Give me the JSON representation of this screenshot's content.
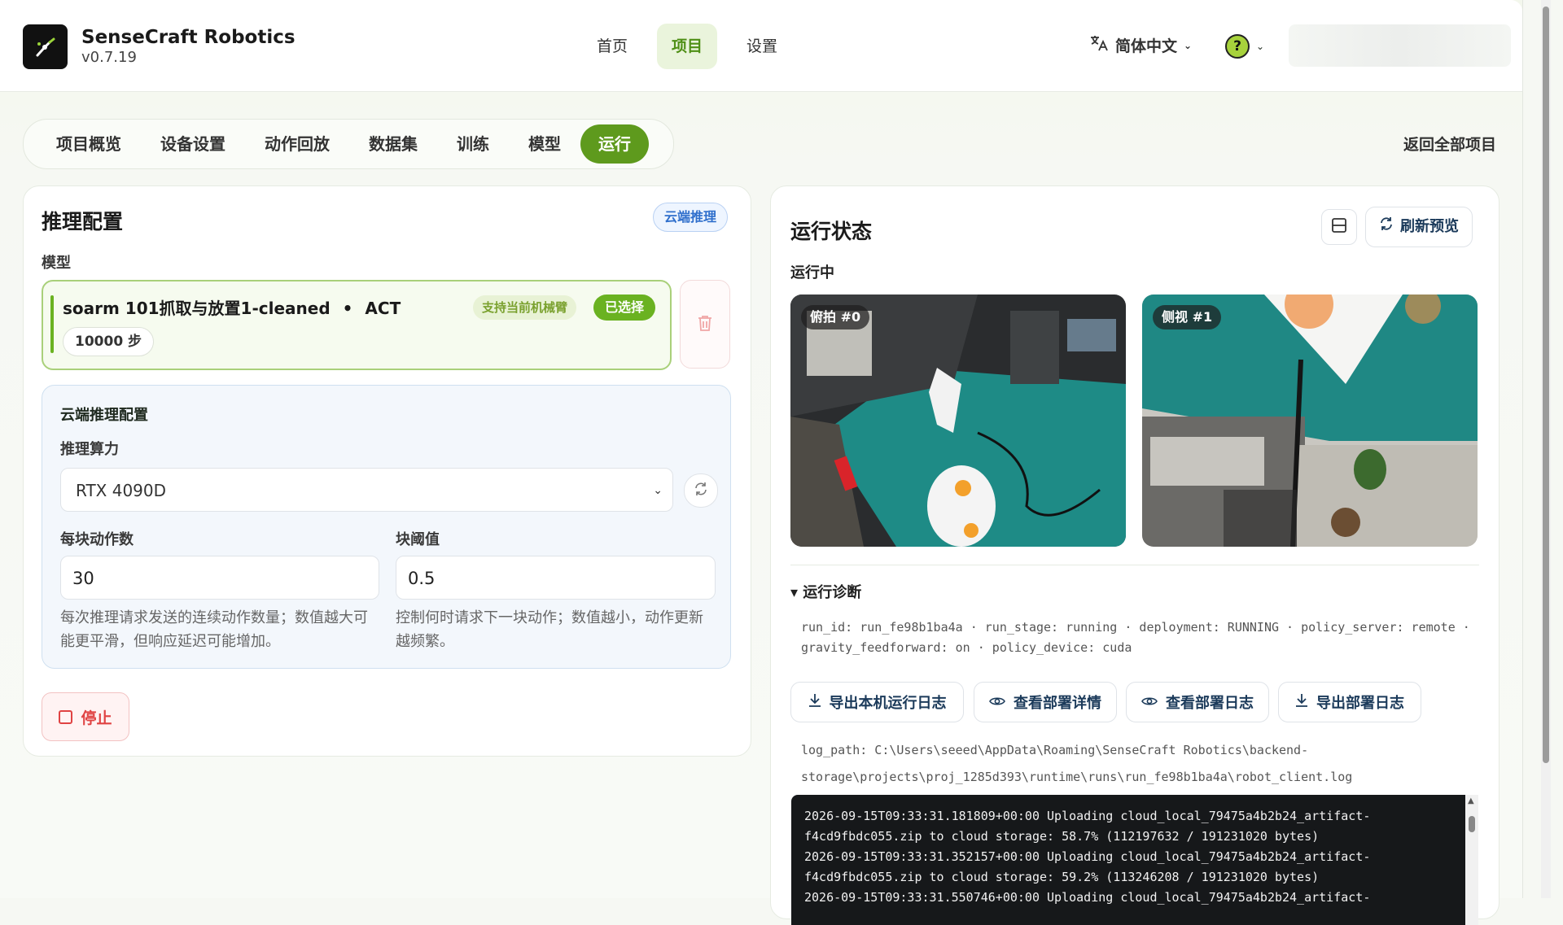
{
  "app": {
    "name": "SenseCraft Robotics",
    "version": "v0.7.19"
  },
  "nav": {
    "items": [
      "首页",
      "项目",
      "设置"
    ],
    "active": "项目"
  },
  "header": {
    "language": "简体中文"
  },
  "tabs": {
    "items": [
      "项目概览",
      "设备设置",
      "动作回放",
      "数据集",
      "训练",
      "模型",
      "运行"
    ],
    "active": "运行",
    "back_all": "返回全部项目"
  },
  "inference": {
    "title": "推理配置",
    "mode_badge": "云端推理",
    "model_label": "模型",
    "model": {
      "name": "soarm 101抓取与放置1-cleaned",
      "separator": "•",
      "policy": "ACT",
      "support_badge": "支持当前机械臂",
      "selected_badge": "已选择",
      "steps": "10000 步"
    },
    "cloud": {
      "title": "云端推理配置",
      "compute_label": "推理算力",
      "compute_value": "RTX 4090D",
      "chunk_label": "每块动作数",
      "chunk_value": "30",
      "chunk_hint": "每次推理请求发送的连续动作数量；数值越大可能更平滑，但响应延迟可能增加。",
      "threshold_label": "块阈值",
      "threshold_value": "0.5",
      "threshold_hint": "控制何时请求下一块动作；数值越小，动作更新越频繁。"
    },
    "stop_label": "停止"
  },
  "status": {
    "title": "运行状态",
    "refresh_label": "刷新预览",
    "running_label": "运行中",
    "cameras": [
      {
        "label": "俯拍 #0"
      },
      {
        "label": "侧视 #1"
      }
    ],
    "diagnostics_title": "▾ 运行诊断",
    "diag_line1": "run_id: run_fe98b1ba4a · run_stage: running · deployment: RUNNING · policy_server: remote ·",
    "diag_line2": "gravity_feedforward: on · policy_device: cuda",
    "buttons": {
      "export_local": "导出本机运行日志",
      "view_detail": "查看部署详情",
      "view_log": "查看部署日志",
      "export_deploy": "导出部署日志"
    },
    "log_path1": "log_path: C:\\Users\\seeed\\AppData\\Roaming\\SenseCraft Robotics\\backend-",
    "log_path2": "storage\\projects\\proj_1285d393\\runtime\\runs\\run_fe98b1ba4a\\robot_client.log",
    "terminal": [
      "2026-09-15T09:33:31.181809+00:00 Uploading cloud_local_79475a4b2b24_artifact-",
      "f4cd9fbdc055.zip to cloud storage: 58.7% (112197632 / 191231020 bytes)",
      "2026-09-15T09:33:31.352157+00:00 Uploading cloud_local_79475a4b2b24_artifact-",
      "f4cd9fbdc055.zip to cloud storage: 59.2% (113246208 / 191231020 bytes)",
      "2026-09-15T09:33:31.550746+00:00 Uploading cloud_local_79475a4b2b24_artifact-"
    ]
  },
  "colors": {
    "accent": "#5e9a1d",
    "danger": "#e04343",
    "link": "#2f6fcc"
  }
}
